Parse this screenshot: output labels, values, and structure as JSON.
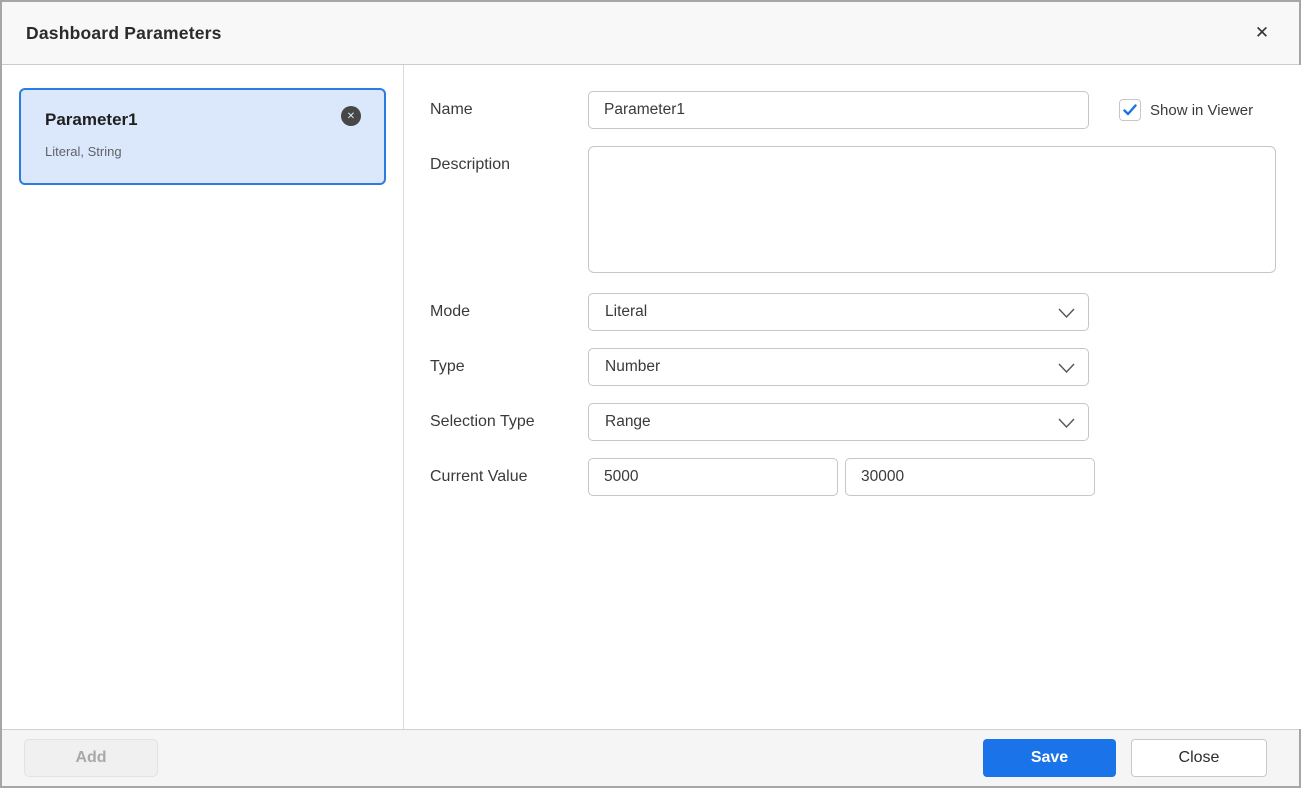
{
  "dialog": {
    "title": "Dashboard Parameters"
  },
  "icons": {
    "close": "✕",
    "remove": "✕",
    "chevron_down": "v-chevron",
    "check": "checkmark"
  },
  "parameter_list": {
    "items": [
      {
        "name": "Parameter1",
        "subtitle": "Literal, String",
        "selected": true
      }
    ]
  },
  "form": {
    "name": {
      "label": "Name",
      "value": "Parameter1"
    },
    "show_in_viewer": {
      "label": "Show in Viewer",
      "checked": true
    },
    "description": {
      "label": "Description",
      "value": ""
    },
    "mode": {
      "label": "Mode",
      "value": "Literal"
    },
    "type": {
      "label": "Type",
      "value": "Number"
    },
    "selection_type": {
      "label": "Selection Type",
      "value": "Range"
    },
    "current_value": {
      "label": "Current Value",
      "min": "5000",
      "max": "30000"
    }
  },
  "footer": {
    "add_label": "Add",
    "save_label": "Save",
    "close_label": "Close"
  },
  "colors": {
    "accent_blue": "#1a73e8",
    "card_background": "#dbe8fb",
    "card_border": "#2b7ce0",
    "header_background": "#f8f8f8",
    "footer_background": "#f5f5f5"
  }
}
